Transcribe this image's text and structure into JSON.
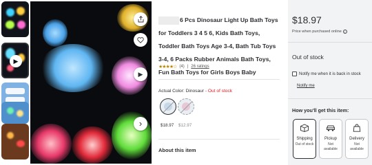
{
  "product": {
    "title": "6 Pcs Dinosaur Light Up Bath Toys for Toddlers 3 4 5 6, Kids Bath Toys, Toddler Bath Toys Age 3-4, Bath Tub Toys 3-4, 6 Packs Rubber Animals Bath Toys, Fun Bath Toys for Girls Boys Baby",
    "rating_stars": 4,
    "rating_stars_display": "★★★★☆",
    "rating_value": "(4)",
    "review_count": "26 ratings"
  },
  "color": {
    "label": "Actual Color:",
    "selected": "Dinosaur",
    "separator": " - ",
    "status": "Out of stock",
    "swatches": [
      {
        "price": "$18.97"
      },
      {
        "price": "$12.97"
      }
    ]
  },
  "about": {
    "heading": "About this item"
  },
  "buybox": {
    "price": "$18.97",
    "price_note": "Price when purchased online",
    "info_icon_glyph": "i",
    "stock_status": "Out of stock",
    "notify_label": "Notify me when it is back in stock",
    "notify_link": "Notify me",
    "fulfillment_title": "How you'll get this item:",
    "options": [
      {
        "label": "Shipping",
        "sub": "Out of stock",
        "icon": "shipping-box-icon"
      },
      {
        "label": "Pickup",
        "sub": "Not available",
        "icon": "pickup-car-icon"
      },
      {
        "label": "Delivery",
        "sub": "Not available",
        "icon": "delivery-bag-icon"
      }
    ]
  },
  "main_image": {
    "video_glyph": "▶",
    "next_glyph": "›"
  },
  "colors": {
    "price_text": "#2e2f32",
    "out_of_stock": "#de1c24",
    "star": "#b98700",
    "buybox_bg": "#f2f3f4"
  }
}
